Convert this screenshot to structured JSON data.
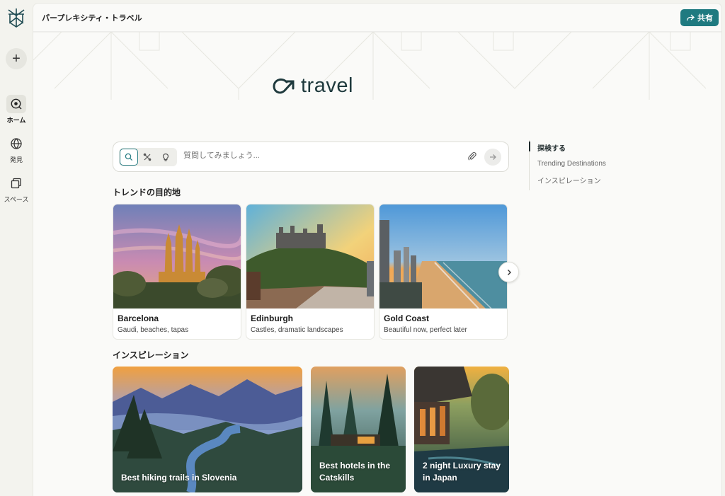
{
  "header": {
    "title": "パープレキシティ・トラベル",
    "share_label": "共有"
  },
  "sidebar": {
    "new_label": "+",
    "items": [
      {
        "label": "ホーム",
        "icon": "home-search-icon",
        "active": true
      },
      {
        "label": "発見",
        "icon": "globe-icon",
        "active": false
      },
      {
        "label": "スペース",
        "icon": "spaces-icon",
        "active": false
      }
    ]
  },
  "brand": {
    "name": "travel",
    "icon": "arrow-loop-icon"
  },
  "search": {
    "placeholder": "質問してみましょう..."
  },
  "trending": {
    "title": "トレンドの目的地",
    "cards": [
      {
        "title": "Barcelona",
        "subtitle": "Gaudi, beaches, tapas"
      },
      {
        "title": "Edinburgh",
        "subtitle": "Castles, dramatic landscapes"
      },
      {
        "title": "Gold Coast",
        "subtitle": "Beautiful now, perfect later"
      }
    ]
  },
  "inspiration": {
    "title": "インスピレーション",
    "cards": [
      {
        "title": "Best hiking trails in Slovenia"
      },
      {
        "title": "Best hotels in the Catskills"
      },
      {
        "title": "2 night Luxury stay in Japan"
      }
    ]
  },
  "toc": {
    "items": [
      {
        "label": "探検する",
        "active": true
      },
      {
        "label": "Trending Destinations",
        "active": false
      },
      {
        "label": "インスピレーション",
        "active": false
      }
    ]
  },
  "colors": {
    "accent": "#1f7a80",
    "background": "#f3f3ee",
    "panel": "#fafaf8"
  }
}
